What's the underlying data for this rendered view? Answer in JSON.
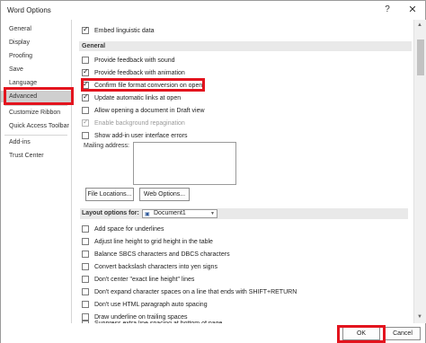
{
  "window": {
    "title": "Word Options",
    "help_glyph": "?",
    "close_glyph": "✕"
  },
  "sidebar": {
    "items": [
      {
        "label": "General"
      },
      {
        "label": "Display"
      },
      {
        "label": "Proofing"
      },
      {
        "label": "Save"
      },
      {
        "label": "Language"
      },
      {
        "label": "Advanced",
        "selected": true
      },
      {
        "label": "Customize Ribbon"
      },
      {
        "label": "Quick Access Toolbar"
      },
      {
        "label": "Add-ins"
      },
      {
        "label": "Trust Center"
      }
    ]
  },
  "top_option": {
    "label": "Embed linguistic data",
    "checked": true
  },
  "general": {
    "header": "General",
    "options": [
      {
        "label": "Provide feedback with sound",
        "checked": false,
        "disabled": false
      },
      {
        "label": "Provide feedback with animation",
        "checked": true,
        "disabled": false
      },
      {
        "label": "Confirm file format conversion on open",
        "checked": true,
        "disabled": false
      },
      {
        "label": "Update automatic links at open",
        "checked": true,
        "disabled": false
      },
      {
        "label": "Allow opening a document in Draft view",
        "checked": false,
        "disabled": false
      },
      {
        "label": "Enable background repagination",
        "checked": true,
        "disabled": true
      },
      {
        "label": "Show add-in user interface errors",
        "checked": false,
        "disabled": false
      }
    ],
    "mailing_address_label": "Mailing address:",
    "file_locations_button": "File Locations...",
    "web_options_button": "Web Options..."
  },
  "layout": {
    "header": "Layout options for:",
    "document_select": "Document1",
    "options": [
      {
        "label": "Add space for underlines",
        "checked": false
      },
      {
        "label": "Adjust line height to grid height in the table",
        "checked": false
      },
      {
        "label": "Balance SBCS characters and DBCS characters",
        "checked": false
      },
      {
        "label": "Convert backslash characters into yen signs",
        "checked": false
      },
      {
        "label": "Don't center \"exact line height\" lines",
        "checked": false
      },
      {
        "label": "Don't expand character spaces on a line that ends with SHIFT+RETURN",
        "checked": false
      },
      {
        "label": "Don't use HTML paragraph auto spacing",
        "checked": false
      },
      {
        "label": "Draw underline on trailing spaces",
        "checked": false
      },
      {
        "label": "Suppress extra line spacing at bottom of page",
        "checked": false
      }
    ]
  },
  "footer": {
    "ok_label": "OK",
    "cancel_label": "Cancel"
  },
  "colors": {
    "highlight": "#e3141e",
    "selected_nav": "#cfcfcf",
    "section_bg": "#e9e9e9"
  }
}
